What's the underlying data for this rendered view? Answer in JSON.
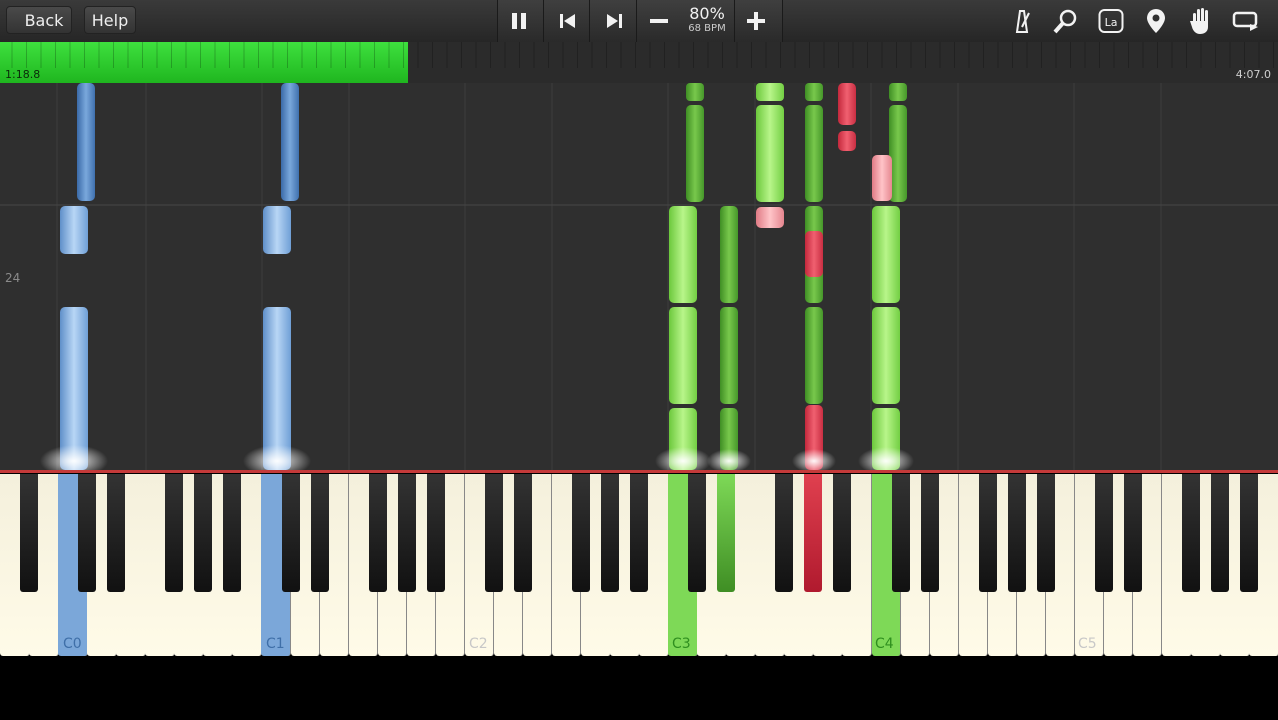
{
  "toolbar": {
    "back_label": "Back",
    "help_label": "Help",
    "speed_percent": "80%",
    "tempo": "68 BPM",
    "icons": [
      "pause-icon",
      "skip-back-icon",
      "skip-forward-icon",
      "minus-icon",
      "plus-icon",
      "metronome-icon",
      "zoom-icon",
      "note-label-icon",
      "location-pin-icon",
      "hand-icon",
      "loop-icon"
    ],
    "note_label_text": "La"
  },
  "progress": {
    "elapsed": "1:18.8",
    "total": "4:07.0",
    "fraction": 0.319
  },
  "roll": {
    "measure_label": "24"
  },
  "keyboard": {
    "octave_labels": [
      "C0",
      "C1",
      "C2",
      "C3",
      "C4",
      "C5"
    ],
    "active_keys": [
      "C0",
      "C1",
      "C3",
      "C4"
    ]
  },
  "colors": {
    "left_hand": "#7ba7d9",
    "right_hand": "#7ed957",
    "accent": "#e04a5a",
    "progress": "#2fce2f"
  }
}
